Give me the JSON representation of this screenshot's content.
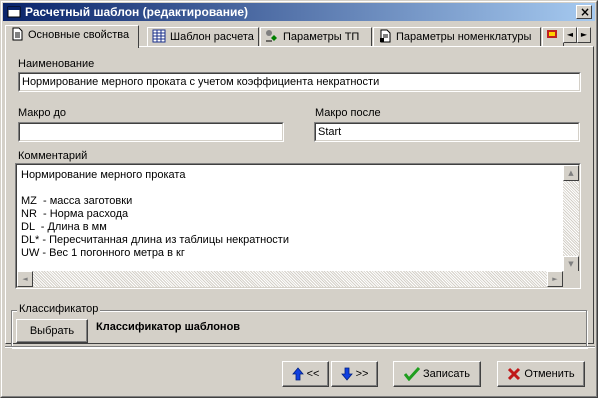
{
  "window": {
    "title": "Расчетный шаблон (редактирование)",
    "close_glyph": "×"
  },
  "tabs": [
    {
      "label": "Основные свойства",
      "icon": "document-icon",
      "active": true
    },
    {
      "label": "Шаблон расчета",
      "icon": "table-icon",
      "active": false
    },
    {
      "label": "Параметры ТП",
      "icon": "process-params-icon",
      "active": false
    },
    {
      "label": "Параметры номенклатуры",
      "icon": "nomenclature-icon",
      "active": false
    },
    {
      "label": "",
      "icon": "extra-tab-icon",
      "active": false
    }
  ],
  "tab_scroll": {
    "left": "◄",
    "right": "►"
  },
  "form": {
    "name_label": "Наименование",
    "name_value": "Нормирование мерного проката с учетом коэффициента некратности",
    "macro_before_label": "Макро до",
    "macro_before_value": "",
    "macro_after_label": "Макро после",
    "macro_after_value": "Start",
    "comment_label": "Комментарий",
    "comment_value": "Нормирование мерного проката\n\nMZ  - масса заготовки\nNR  - Норма расхода\nDL  - Длина в мм\nDL* - Пересчитанная длина из таблицы некратности\nUW - Вес 1 погонного метра в кг"
  },
  "scroll_glyphs": {
    "up": "▲",
    "down": "▼",
    "left": "◄",
    "right": "►"
  },
  "classifier": {
    "group_label": "Классификатор",
    "select_button": "Выбрать",
    "name": "Классификатор шаблонов"
  },
  "footer": {
    "prev_label": "<<",
    "next_label": ">>",
    "save_label": "Записать",
    "cancel_label": "Отменить"
  },
  "colors": {
    "title_start": "#0a246a",
    "title_end": "#a6caf0",
    "face": "#d4d0c8",
    "save_check": "#1f9e1f",
    "cancel_x": "#c01818",
    "arrow_blue": "#1040e0"
  }
}
